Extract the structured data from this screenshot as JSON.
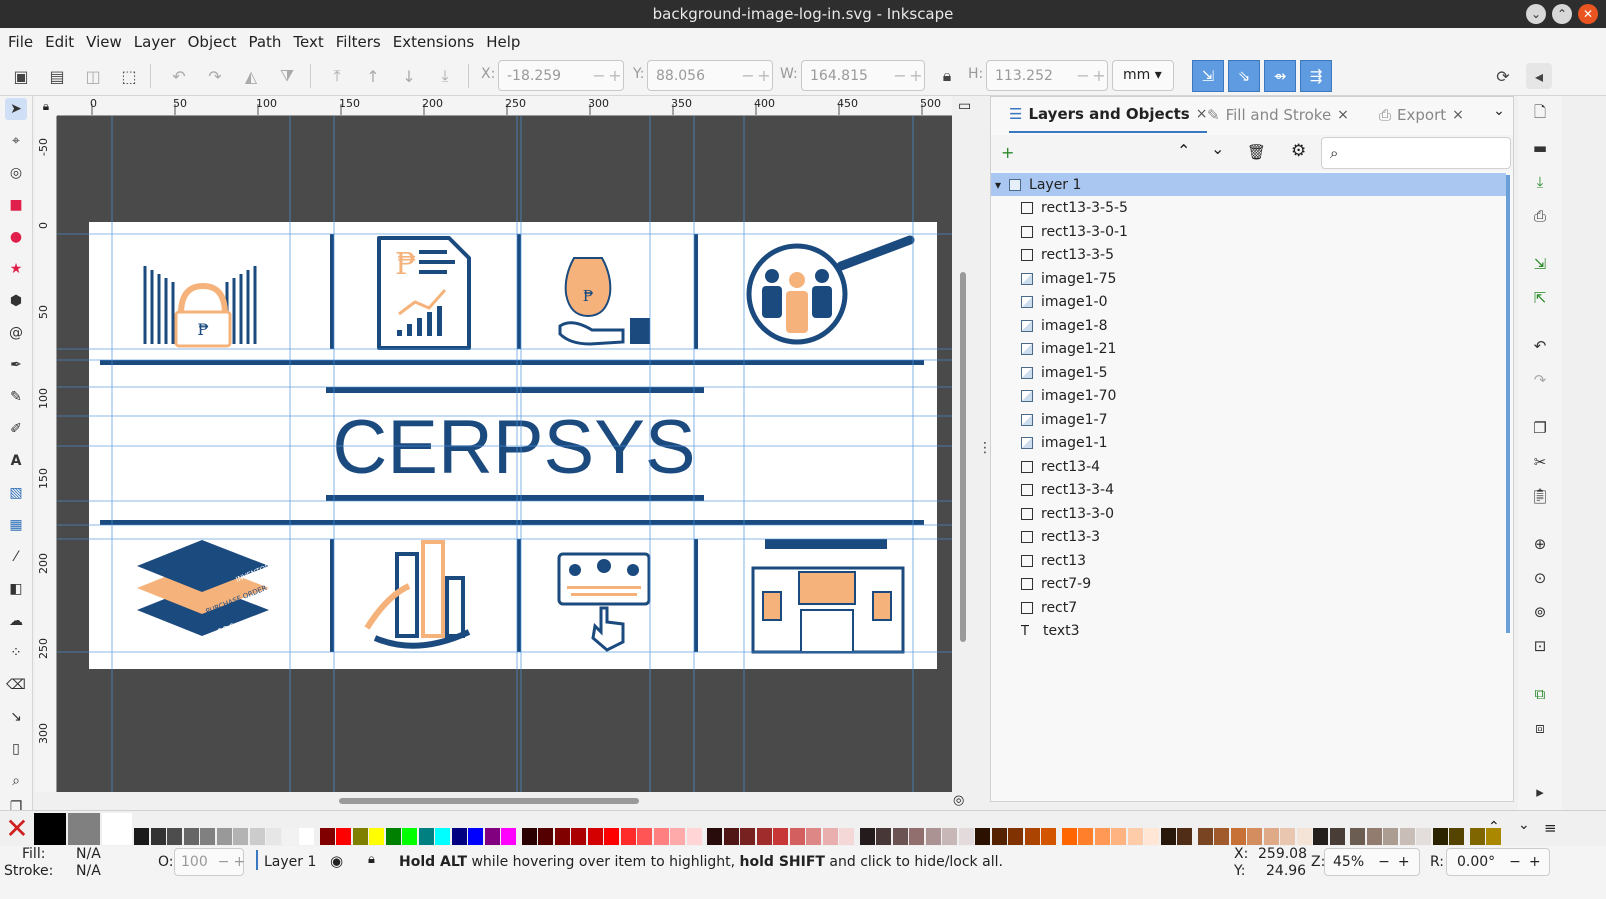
{
  "window": {
    "title": "background-image-log-in.svg - Inkscape"
  },
  "menu": [
    "File",
    "Edit",
    "View",
    "Layer",
    "Object",
    "Path",
    "Text",
    "Filters",
    "Extensions",
    "Help"
  ],
  "toolbar": {
    "x_label": "X:",
    "x": "-18.259",
    "y_label": "Y:",
    "y": "88.056",
    "w_label": "W:",
    "w": "164.815",
    "h_label": "H:",
    "h": "113.252",
    "unit": "mm"
  },
  "ruler_h": [
    "0",
    "50",
    "100",
    "150",
    "200",
    "250",
    "300",
    "350",
    "400",
    "450",
    "500"
  ],
  "ruler_v": [
    "-50",
    "0",
    "50",
    "100",
    "150",
    "200",
    "250",
    "300"
  ],
  "canvas": {
    "logo_text": "CERPSYS",
    "peso": "₱",
    "stack_labels": [
      "INVENTORY",
      "PURCHASE ORDER",
      "P.O.S"
    ]
  },
  "panel": {
    "tabs": [
      {
        "label": "Layers and Objects",
        "close": "×"
      },
      {
        "label": "Fill and Stroke",
        "close": "×"
      },
      {
        "label": "Export",
        "close": "×"
      }
    ],
    "tree": [
      {
        "label": "Layer 1",
        "kind": "layer"
      },
      {
        "label": "rect13-3-5-5",
        "kind": "rect"
      },
      {
        "label": "rect13-3-0-1",
        "kind": "rect"
      },
      {
        "label": "rect13-3-5",
        "kind": "rect"
      },
      {
        "label": "image1-75",
        "kind": "image"
      },
      {
        "label": "image1-0",
        "kind": "image"
      },
      {
        "label": "image1-8",
        "kind": "image"
      },
      {
        "label": "image1-21",
        "kind": "image"
      },
      {
        "label": "image1-5",
        "kind": "image"
      },
      {
        "label": "image1-70",
        "kind": "image"
      },
      {
        "label": "image1-7",
        "kind": "image"
      },
      {
        "label": "image1-1",
        "kind": "image"
      },
      {
        "label": "rect13-4",
        "kind": "rect"
      },
      {
        "label": "rect13-3-4",
        "kind": "rect"
      },
      {
        "label": "rect13-3-0",
        "kind": "rect"
      },
      {
        "label": "rect13-3",
        "kind": "rect"
      },
      {
        "label": "rect13",
        "kind": "rect"
      },
      {
        "label": "rect7-9",
        "kind": "rect"
      },
      {
        "label": "rect7",
        "kind": "rect"
      },
      {
        "label": "text3",
        "kind": "text"
      }
    ]
  },
  "palette": {
    "colors": [
      "#1a1a1a",
      "#333333",
      "#4d4d4d",
      "#666666",
      "#808080",
      "#999999",
      "#b3b3b3",
      "#cccccc",
      "#e6e6e6",
      "#f2f2f2",
      "#ffffff",
      "#800000",
      "#ff0000",
      "#808000",
      "#ffff00",
      "#008000",
      "#00ff00",
      "#008080",
      "#00ffff",
      "#000080",
      "#0000ff",
      "#800080",
      "#ff00ff",
      "#2b0000",
      "#550000",
      "#800000",
      "#aa0000",
      "#d40000",
      "#ff0000",
      "#ff2a2a",
      "#ff5555",
      "#ff8080",
      "#ffaaaa",
      "#ffd5d5",
      "#280b0b",
      "#501616",
      "#782121",
      "#a02c2c",
      "#c83737",
      "#d35f5f",
      "#de8787",
      "#e9afaf",
      "#f4d7d7",
      "#241c1c",
      "#483737",
      "#6c5353",
      "#916f6f",
      "#ac9393",
      "#c8b7b7",
      "#e3dbdb",
      "#2b1100",
      "#552200",
      "#803300",
      "#aa4400",
      "#d45500",
      "#ff6600",
      "#ff7f2a",
      "#ff9955",
      "#ffb380",
      "#ffccaa",
      "#ffe6d5",
      "#28170b",
      "#502d16",
      "#784421",
      "#a05a2c",
      "#c87137",
      "#d38d5f",
      "#deaa87",
      "#e9c6af",
      "#f4e3d7",
      "#241f1c",
      "#483e37",
      "#6c5d53",
      "#917c6f",
      "#ac9d93",
      "#c8beb7",
      "#e3dedb",
      "#2b2200",
      "#554400",
      "#806600",
      "#aa8800"
    ]
  },
  "status": {
    "fill_label": "Fill:",
    "fill_value": "N/A",
    "stroke_label": "Stroke:",
    "stroke_value": "N/A",
    "opacity_label": "O:",
    "opacity_value": "100",
    "layer": "Layer 1",
    "msg_b1": "Hold ALT",
    "msg_t1": " while hovering over item to highlight, ",
    "msg_b2": "hold SHIFT",
    "msg_t2": " and click to hide/lock all.",
    "x_label": "X:",
    "x": "259.08",
    "y_label": "Y:",
    "y": "24.96",
    "zoom_label": "Z:",
    "zoom": "45%",
    "rot_label": "R:",
    "rotation": "0.00°"
  }
}
